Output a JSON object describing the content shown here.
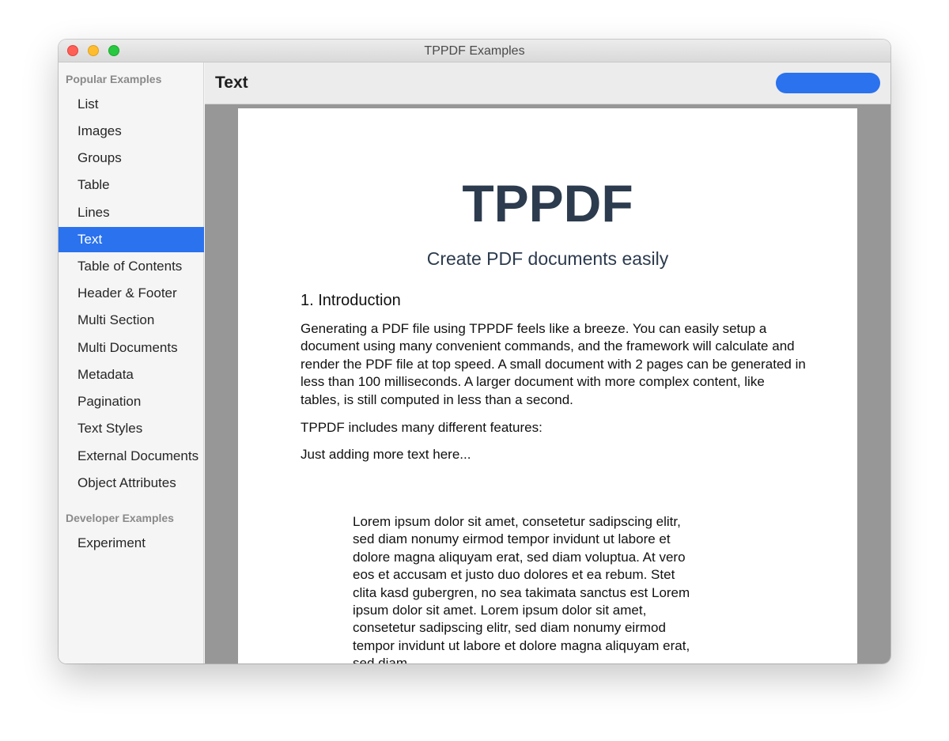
{
  "window": {
    "title": "TPPDF Examples"
  },
  "sidebar": {
    "sections": [
      {
        "header": "Popular Examples",
        "items": [
          {
            "label": "List"
          },
          {
            "label": "Images"
          },
          {
            "label": "Groups"
          },
          {
            "label": "Table"
          },
          {
            "label": "Lines"
          },
          {
            "label": "Text",
            "selected": true
          },
          {
            "label": "Table of Contents"
          },
          {
            "label": "Header & Footer"
          },
          {
            "label": "Multi Section"
          },
          {
            "label": "Multi Documents"
          },
          {
            "label": "Metadata"
          },
          {
            "label": "Pagination"
          },
          {
            "label": "Text Styles"
          },
          {
            "label": "External Documents"
          },
          {
            "label": "Object Attributes"
          }
        ]
      },
      {
        "header": "Developer Examples",
        "items": [
          {
            "label": "Experiment"
          }
        ]
      }
    ]
  },
  "toolbar": {
    "title": "Text"
  },
  "document": {
    "title": "TPPDF",
    "subtitle": "Create PDF documents easily",
    "heading": "1. Introduction",
    "paragraph1": "Generating a PDF file using TPPDF feels like a breeze. You can easily setup a document using many convenient commands, and the framework will calculate and render the PDF file at top speed. A small document with 2 pages can be generated in less than 100 milliseconds. A larger document with more complex content, like tables, is still computed in less than a second.",
    "paragraph2": "TPPDF includes many different features:",
    "paragraph3": "Just adding more text here...",
    "lorem": "Lorem ipsum dolor sit amet, consetetur sadipscing elitr, sed diam nonumy eirmod tempor invidunt ut labore et dolore magna aliquyam erat, sed diam voluptua. At vero eos et accusam et justo duo dolores et ea rebum. Stet clita kasd gubergren, no sea takimata sanctus est Lorem ipsum dolor sit amet. Lorem ipsum dolor sit amet, consetetur sadipscing elitr, sed diam nonumy eirmod tempor invidunt ut labore et dolore magna aliquyam erat, sed diam"
  },
  "colors": {
    "accent": "#2a72ee",
    "title_text": "#2c3b4e",
    "canvas_gray": "#979797"
  },
  "icons": [
    "close-icon",
    "minimize-icon",
    "zoom-icon"
  ]
}
